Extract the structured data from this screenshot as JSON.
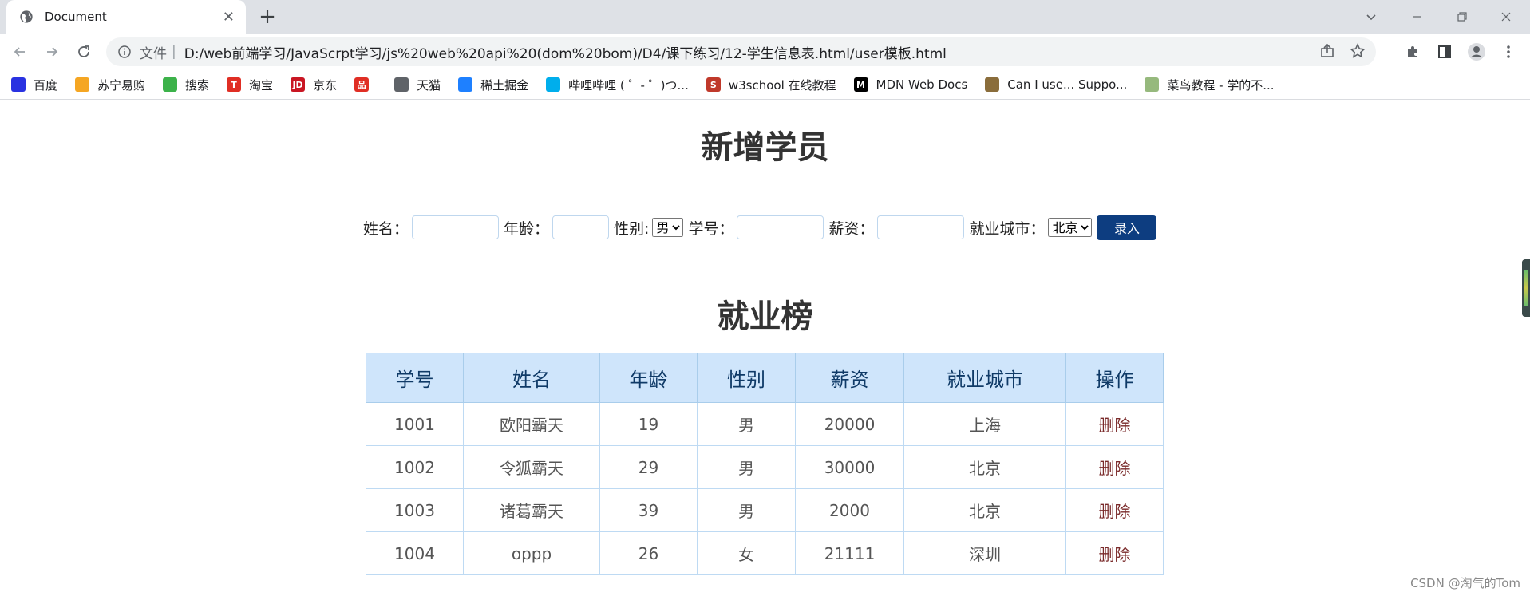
{
  "browser": {
    "tab_title": "Document",
    "tab_close": "✕",
    "new_tab": "+",
    "address": {
      "scheme_label": "文件",
      "separator": "|",
      "url": "D:/web前端学习/JavaScrpt学习/js%20web%20api%20(dom%20bom)/D4/课下练习/12-学生信息表.html/user模板.html"
    },
    "bookmarks": [
      {
        "label": "百度",
        "icon": "baidu-paw-icon",
        "color": "#2932e1"
      },
      {
        "label": "苏宁易购",
        "icon": "suning-lion-icon",
        "color": "#f5a623"
      },
      {
        "label": "搜索",
        "icon": "search-e-icon",
        "color": "#3cb24a"
      },
      {
        "label": "淘宝",
        "icon": "taobao-icon",
        "color": "#e02e24"
      },
      {
        "label": "京东",
        "icon": "jd-icon",
        "color": "#c91623"
      },
      {
        "label": "",
        "icon": "pinduoduo-icon",
        "color": "#e02e24"
      },
      {
        "label": "天猫",
        "icon": "globe-icon",
        "color": "#5f6368"
      },
      {
        "label": "稀土掘金",
        "icon": "juejin-icon",
        "color": "#1e80ff"
      },
      {
        "label": "哔哩哔哩 ( ゜- ゜)つ...",
        "icon": "bilibili-tv-icon",
        "color": "#00aeec"
      },
      {
        "label": "w3school 在线教程",
        "icon": "w3school-icon",
        "color": "#c0392b"
      },
      {
        "label": "MDN Web Docs",
        "icon": "mdn-icon",
        "color": "#000000"
      },
      {
        "label": "Can I use... Suppo...",
        "icon": "caniuse-icon",
        "color": "#8a6d3b"
      },
      {
        "label": "菜鸟教程 - 学的不...",
        "icon": "runoob-icon",
        "color": "#96b97d"
      }
    ]
  },
  "page": {
    "add_title": "新增学员",
    "form": {
      "name_label": "姓名：",
      "age_label": "年龄：",
      "gender_label": "性别:",
      "gender_selected": "男",
      "id_label": "学号：",
      "salary_label": "薪资：",
      "city_label": "就业城市：",
      "city_selected": "北京",
      "submit_label": "录入"
    },
    "rank_title": "就业榜",
    "table": {
      "headers": [
        "学号",
        "姓名",
        "年龄",
        "性别",
        "薪资",
        "就业城市",
        "操作"
      ],
      "rows": [
        [
          "1001",
          "欧阳霸天",
          "19",
          "男",
          "20000",
          "上海",
          "删除"
        ],
        [
          "1002",
          "令狐霸天",
          "29",
          "男",
          "30000",
          "北京",
          "删除"
        ],
        [
          "1003",
          "诸葛霸天",
          "39",
          "男",
          "2000",
          "北京",
          "删除"
        ],
        [
          "1004",
          "oppp",
          "26",
          "女",
          "21111",
          "深圳",
          "删除"
        ]
      ]
    },
    "watermark": "CSDN @淘气的Tom"
  },
  "colors": {
    "header_bg": "#cfe5fb",
    "header_text": "#0f3a67",
    "submit_bg": "#0d3d80",
    "delete_text": "#7a2a2a"
  }
}
